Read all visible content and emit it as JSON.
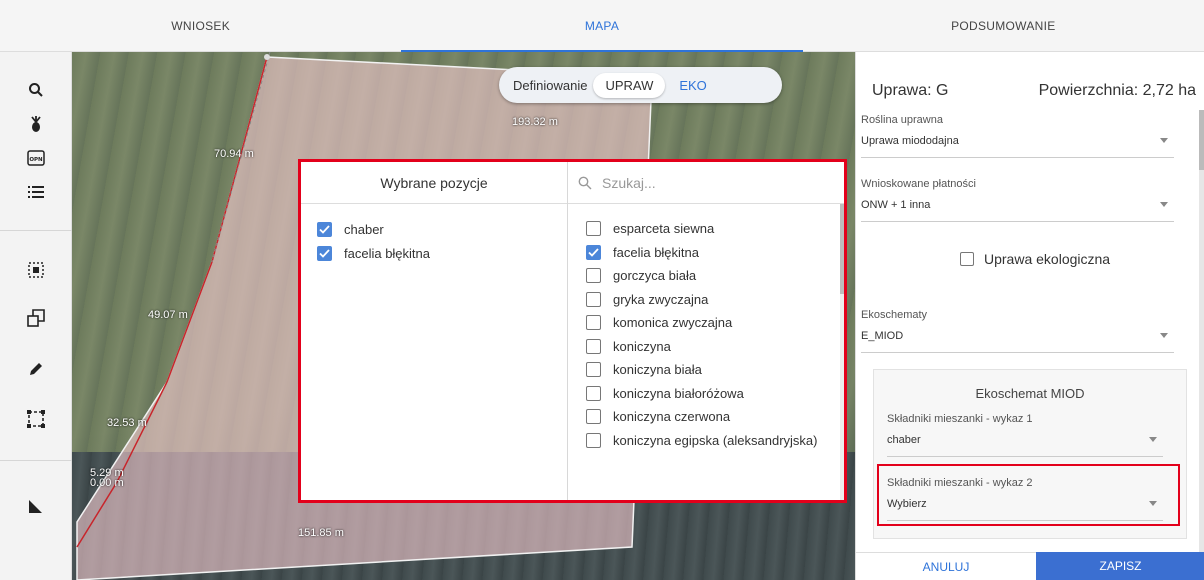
{
  "tabs": [
    {
      "label": "WNIOSEK",
      "active": false
    },
    {
      "label": "MAPA",
      "active": true
    },
    {
      "label": "PODSUMOWANIE",
      "active": false
    }
  ],
  "toolbar": {
    "tools": [
      "search-icon",
      "plant-icon",
      "opn-icon",
      "list-icon",
      "select-area-icon",
      "copy-shape-icon",
      "pencil-icon",
      "bounding-box-icon",
      "measure-icon"
    ],
    "opn_text": "OPN"
  },
  "map": {
    "segment_labels": [
      "193.32 m",
      "70.94 m",
      "49.07 m",
      "32.53 m",
      "5.29 m",
      "0.00 m",
      "151.85 m"
    ],
    "mode": {
      "label": "Definiowanie",
      "active": "UPRAW",
      "other": "EKO"
    }
  },
  "dialog": {
    "selected_header": "Wybrane pozycje",
    "selected": [
      "chaber",
      "facelia błękitna"
    ],
    "search_placeholder": "Szukaj...",
    "options": [
      {
        "label": "esparceta siewna",
        "checked": false
      },
      {
        "label": "facelia błękitna",
        "checked": true
      },
      {
        "label": "gorczyca biała",
        "checked": false
      },
      {
        "label": "gryka zwyczajna",
        "checked": false
      },
      {
        "label": "komonica zwyczajna",
        "checked": false
      },
      {
        "label": "koniczyna",
        "checked": false
      },
      {
        "label": "koniczyna biała",
        "checked": false
      },
      {
        "label": "koniczyna białoróżowa",
        "checked": false
      },
      {
        "label": "koniczyna czerwona",
        "checked": false
      },
      {
        "label": "koniczyna egipska (aleksandryjska)",
        "checked": false
      }
    ]
  },
  "panel": {
    "title": "Uprawa: G",
    "area": "Powierzchnia: 2,72 ha",
    "crop": {
      "label": "Roślina uprawna",
      "value": "Uprawa miododajna"
    },
    "payments": {
      "label": "Wnioskowane płatności",
      "value": "ONW + 1 inna"
    },
    "organic_label": "Uprawa ekologiczna",
    "ecoschemes": {
      "label": "Ekoschematy",
      "value": "E_MIOD"
    },
    "sub_title": "Ekoschemat MIOD",
    "mix1": {
      "label": "Składniki mieszanki - wykaz 1",
      "value": "chaber"
    },
    "mix2": {
      "label": "Składniki mieszanki - wykaz 2",
      "value": "Wybierz"
    },
    "cancel": "ANULUJ",
    "save": "ZAPISZ"
  },
  "colors": {
    "accent": "#2e73d9",
    "highlight": "#e3001b",
    "save_bg": "#3b6fd1"
  }
}
